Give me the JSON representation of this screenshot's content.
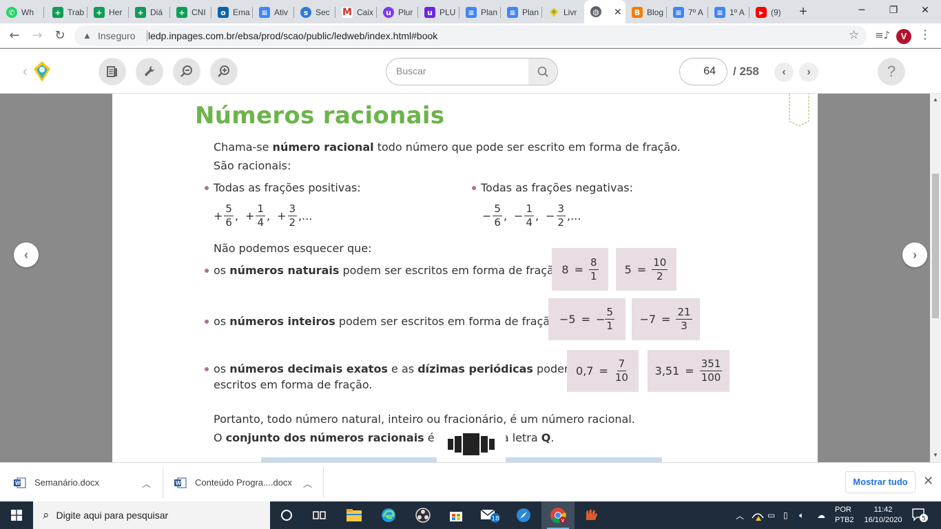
{
  "tabs": [
    {
      "title": "Wh",
      "icon": "whatsapp-icon",
      "color": "#25d366"
    },
    {
      "title": "Trab",
      "icon": "sheets-icon",
      "color": "#0f9d58"
    },
    {
      "title": "Her",
      "icon": "sheets-icon",
      "color": "#0f9d58"
    },
    {
      "title": "Diá",
      "icon": "sheets-icon",
      "color": "#0f9d58"
    },
    {
      "title": "CNI",
      "icon": "sheets-icon",
      "color": "#0f9d58"
    },
    {
      "title": "Ema",
      "icon": "outlook-icon",
      "color": "#0a64ad"
    },
    {
      "title": "Ativ",
      "icon": "docs-icon",
      "color": "#4285f4"
    },
    {
      "title": "Sec",
      "icon": "edge-icon",
      "color": "#2f7ad8"
    },
    {
      "title": "Caix",
      "icon": "gmail-icon",
      "color": "#d93025"
    },
    {
      "title": "Plur",
      "icon": "plurall-icon",
      "color": "#7c3aed"
    },
    {
      "title": "PLU",
      "icon": "plurall-icon",
      "color": "#6d28d9"
    },
    {
      "title": "Plan",
      "icon": "docs-icon",
      "color": "#4285f4"
    },
    {
      "title": "Plan",
      "icon": "docs-icon",
      "color": "#4285f4"
    },
    {
      "title": "Livr",
      "icon": "book-icon",
      "color": "#6db44b"
    },
    {
      "title": "",
      "icon": "globe-icon",
      "color": "#5f6368",
      "active": true
    },
    {
      "title": "Blog",
      "icon": "blogger-icon",
      "color": "#f57d00"
    },
    {
      "title": "7º A",
      "icon": "docs-icon",
      "color": "#4285f4"
    },
    {
      "title": "1º A",
      "icon": "docs-icon",
      "color": "#4285f4"
    },
    {
      "title": "(9)",
      "icon": "youtube-icon",
      "color": "#ff0000"
    }
  ],
  "omnibox": {
    "security_label": "Inseguro",
    "url": "ledp.inpages.com.br/ebsa/prod/scao/public/ledweb/index.html#book"
  },
  "profile_initial": "V",
  "reader": {
    "search_placeholder": "Buscar",
    "current_page": "64",
    "total_pages": "/ 258",
    "help_label": "?"
  },
  "book": {
    "title": "Números racionais",
    "intro_pre": "Chama-se ",
    "intro_bold": "número racional",
    "intro_post": " todo número que pode ser escrito em forma de fração.",
    "sao_racionais": "São racionais:",
    "positive_label": "Todas as frações positivas:",
    "negative_label": "Todas as frações negativas:",
    "positive_fractions": [
      {
        "sign": "+",
        "num": "5",
        "den": "6"
      },
      {
        "sign": "+",
        "num": "1",
        "den": "4"
      },
      {
        "sign": "+",
        "num": "3",
        "den": "2"
      }
    ],
    "negative_fractions": [
      {
        "sign": "−",
        "num": "5",
        "den": "6"
      },
      {
        "sign": "−",
        "num": "1",
        "den": "4"
      },
      {
        "sign": "−",
        "num": "3",
        "den": "2"
      }
    ],
    "separator": ",",
    "ellipsis": ",...",
    "remember": "Não podemos esquecer que:",
    "naturais_pre": "os ",
    "naturais_bold": "números naturais",
    "naturais_post": " podem ser escritos em forma de fração;",
    "inteiros_pre": "os ",
    "inteiros_bold": "números inteiros",
    "inteiros_post": " podem ser escritos em forma de fração;",
    "decimais_pre": "os ",
    "decimais_bold1": "números decimais exatos",
    "decimais_mid": " e as ",
    "decimais_bold2": "dízimas periódicas",
    "decimais_post": " podem ser",
    "decimais_line2": "escritos em forma de fração.",
    "equals": "=",
    "boxes": {
      "nat1": {
        "lhs": "8",
        "num": "8",
        "den": "1"
      },
      "nat2": {
        "lhs": "5",
        "num": "10",
        "den": "2"
      },
      "int1": {
        "lhs": "−5",
        "sign": "−",
        "num": "5",
        "den": "1"
      },
      "int2": {
        "lhs": "−7",
        "num": "21",
        "den": "3"
      },
      "dec1": {
        "lhs": "0,7",
        "num": "7",
        "den": "10"
      },
      "dec2": {
        "lhs": "3,51",
        "num": "351",
        "den": "100"
      }
    },
    "portanto": "Portanto, todo número natural, inteiro ou fracionário, é um número racional.",
    "conjunto_pre": "O ",
    "conjunto_bold": "conjunto dos números racionais",
    "conjunto_mid": " é repr",
    "conjunto_end": "ela letra ",
    "conjunto_letter": "Q",
    "conjunto_period": "."
  },
  "downloads": {
    "items": [
      "Semanário.docx",
      "Conteúdo Progra....docx"
    ],
    "show_all": "Mostrar tudo"
  },
  "taskbar": {
    "search_placeholder": "Digite aqui para pesquisar",
    "mail_badge": "18",
    "lang_top": "POR",
    "lang_bottom": "PTB2",
    "time": "11:42",
    "date": "16/10/2020",
    "notifications": "5"
  },
  "colors": {
    "title_green": "#6db44b",
    "bullet_purple": "#b06e9a",
    "box_pink": "#e8dde3",
    "taskbar": "#1f2c3c"
  }
}
